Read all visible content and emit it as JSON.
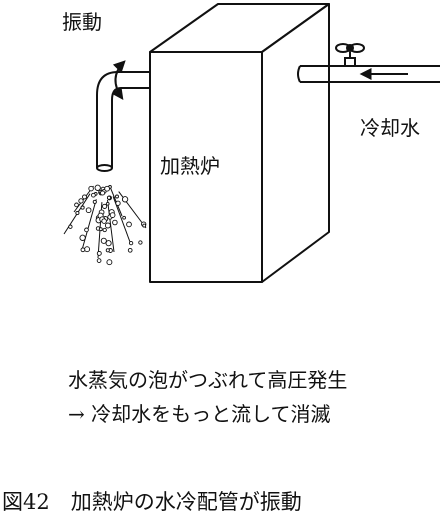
{
  "labels": {
    "vibration": "振動",
    "coolant": "冷却水",
    "furnace": "加熱炉"
  },
  "explanation": {
    "line1": "水蒸気の泡がつぶれて高圧発生",
    "line2": "→ 冷却水をもっと流して消滅"
  },
  "caption": "図42　加熱炉の水冷配管が振動",
  "icons": [
    "faucet-icon",
    "flow-arrow-icon",
    "vibration-arrow-icon"
  ]
}
